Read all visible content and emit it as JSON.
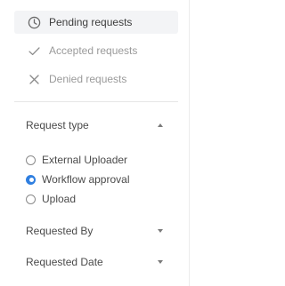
{
  "nav": {
    "items": [
      {
        "label": "Pending requests",
        "icon": "clock-icon",
        "active": true
      },
      {
        "label": "Accepted requests",
        "icon": "check-icon",
        "active": false
      },
      {
        "label": "Denied requests",
        "icon": "x-icon",
        "active": false
      }
    ]
  },
  "filters": {
    "request_type": {
      "label": "Request type",
      "expanded": true,
      "options": [
        "External Uploader",
        "Workflow approval",
        "Upload"
      ],
      "selected": "Workflow approval"
    },
    "requested_by": {
      "label": "Requested By",
      "expanded": false
    },
    "requested_date": {
      "label": "Requested Date",
      "expanded": false
    }
  },
  "colors": {
    "accent": "#2f7fe0",
    "active_bg": "#f3f4f6"
  }
}
